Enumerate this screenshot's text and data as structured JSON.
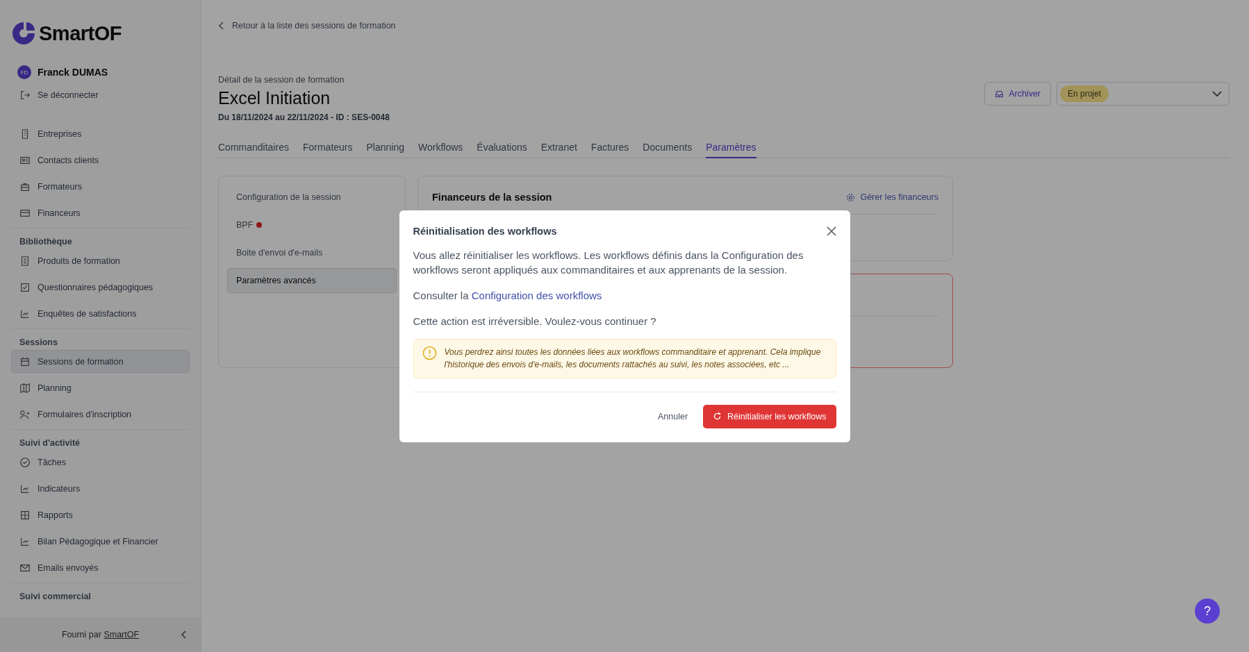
{
  "brand": {
    "name": "SmartOF"
  },
  "user": {
    "initials": "FD",
    "name": "Franck DUMAS"
  },
  "logout": {
    "label": "Se déconnecter"
  },
  "sidebar": {
    "sections": [
      {
        "items": [
          {
            "label": "Entreprises",
            "selected": false
          },
          {
            "label": "Contacts clients",
            "selected": false
          },
          {
            "label": "Formateurs",
            "selected": false
          },
          {
            "label": "Financeurs",
            "selected": false
          }
        ]
      },
      {
        "title": "Bibliothèque",
        "items": [
          {
            "label": "Produits de formation",
            "selected": false
          },
          {
            "label": "Questionnaires pédagogiques",
            "selected": false
          },
          {
            "label": "Enquêtes de satisfactions",
            "selected": false
          }
        ]
      },
      {
        "title": "Sessions",
        "items": [
          {
            "label": "Sessions de formation",
            "selected": true
          },
          {
            "label": "Planning",
            "selected": false
          },
          {
            "label": "Formulaires d'inscription",
            "selected": false
          }
        ]
      },
      {
        "title": "Suivi d'activité",
        "items": [
          {
            "label": "Tâches",
            "selected": false
          },
          {
            "label": "Indicateurs",
            "selected": false
          },
          {
            "label": "Rapports",
            "selected": false
          },
          {
            "label": "Bilan Pédagogique et Financier",
            "selected": false
          },
          {
            "label": "Emails envoyés",
            "selected": false
          }
        ]
      },
      {
        "title": "Suivi commercial"
      }
    ],
    "footer": {
      "text": "Fourni par",
      "link": "SmartOF"
    }
  },
  "back_link": "Retour à la liste des sessions de formation",
  "header": {
    "subtitle": "Détail de la session de formation",
    "title": "Excel Initiation",
    "dates": "Du 18/11/2024 au 22/11/2024 - ID : SES-0048",
    "archive_button": "Archiver",
    "status": "En projet"
  },
  "tabs": [
    {
      "label": "Commanditaires",
      "selected": false
    },
    {
      "label": "Formateurs",
      "selected": false
    },
    {
      "label": "Planning",
      "selected": false
    },
    {
      "label": "Workflows",
      "selected": false
    },
    {
      "label": "Évaluations",
      "selected": false
    },
    {
      "label": "Extranet",
      "selected": false
    },
    {
      "label": "Factures",
      "selected": false
    },
    {
      "label": "Documents",
      "selected": false
    },
    {
      "label": "Paramètres",
      "selected": true
    }
  ],
  "settings_menu": [
    {
      "label": "Configuration de la session",
      "selected": false,
      "alert": false
    },
    {
      "label": "BPF",
      "selected": false,
      "alert": true
    },
    {
      "label": "Boite d'envoi d'e-mails",
      "selected": false,
      "alert": false
    },
    {
      "label": "Paramètres avancés",
      "selected": true,
      "alert": false
    }
  ],
  "financeurs_card": {
    "title": "Financeurs de la session",
    "action": "Gérer les financeurs"
  },
  "modal": {
    "title": "Réinitialisation des workflows",
    "paragraph": "Vous allez réinitialiser les workflows. Les workflows définis dans la Configuration des workflows seront appliqués aux commanditaires et aux apprenants de la session.",
    "consult_text": "Consulter la",
    "consult_link": "Configuration des workflows",
    "question": "Cette action est irréversible. Voulez-vous continuer ?",
    "warning": "Vous perdrez ainsi toutes les données liées aux workflows commanditaire et apprenant. Cela implique l'historique des envois d'e-mails, les documents rattachés au suivi, les notes associées, etc ...",
    "cancel": "Annuler",
    "confirm": "Réinitialiser les workflows"
  },
  "help_button": "?"
}
